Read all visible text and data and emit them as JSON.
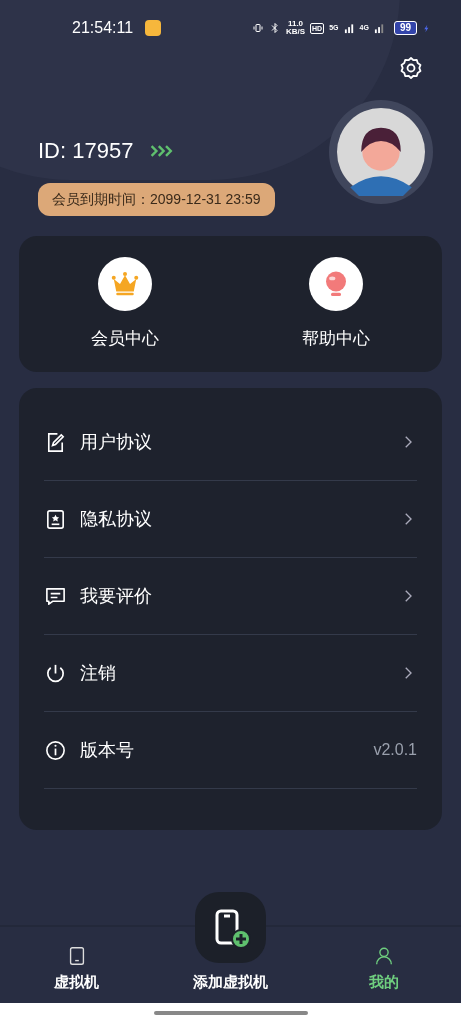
{
  "status_bar": {
    "time": "21:54:11",
    "net_speed": "11.0",
    "net_unit": "KB/S",
    "hd": "HD",
    "net_5g": "5G",
    "net_4g": "4G",
    "battery": "99"
  },
  "profile": {
    "id": "ID: 17957",
    "expiry": "会员到期时间：2099-12-31 23:59"
  },
  "shortcuts": [
    {
      "kind": "crown",
      "label": "会员中心"
    },
    {
      "kind": "bulb",
      "label": "帮助中心"
    }
  ],
  "menu": [
    {
      "label": "用户协议",
      "kind": "link"
    },
    {
      "label": "隐私协议",
      "kind": "link"
    },
    {
      "label": "我要评价",
      "kind": "link"
    },
    {
      "label": "注销",
      "kind": "link"
    },
    {
      "label": "版本号",
      "kind": "value",
      "value": "v2.0.1"
    }
  ],
  "tabs": [
    {
      "kind": "phone",
      "label": "虚拟机",
      "selected": false
    },
    {
      "kind": "add",
      "label": "添加虚拟机",
      "selected": false
    },
    {
      "kind": "user",
      "label": "我的",
      "selected": true
    }
  ]
}
